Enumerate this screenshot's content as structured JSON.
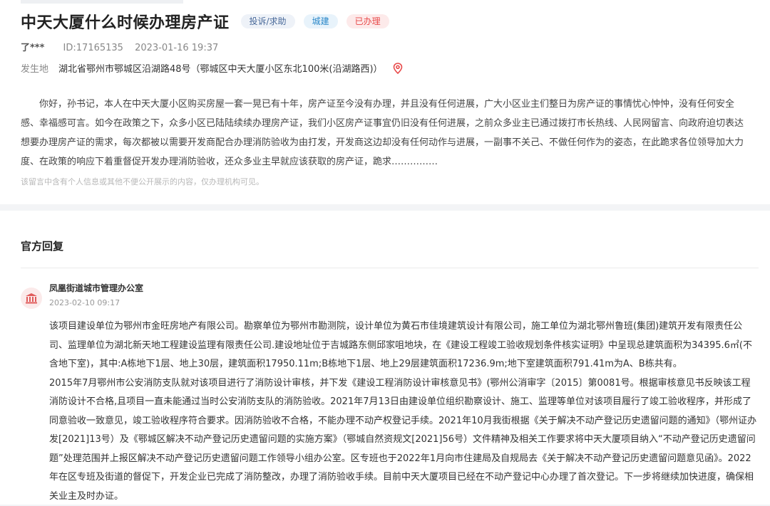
{
  "petition": {
    "title": "中天大厦什么时候办理房产证",
    "tags": {
      "type": "投诉/求助",
      "category": "城建",
      "status": "已办理"
    },
    "author": "了***",
    "id_text": "ID:17165135",
    "datetime": "2023-01-16 19:37",
    "place_label": "发生地",
    "place_value": "湖北省鄂州市鄂城区沿湖路48号（鄂城区中天大厦小区东北100米(沿湖路西)）",
    "place_icon": "location-pin-icon",
    "body": "你好，孙书记，本人在中天大厦小区购买房屋一套一晃已有十年，房产证至今没有办理，并且没有任何进展，广大小区业主们整日为房产证的事情忧心忡忡，没有任何安全感、幸福感可言。如今在政策之下，众多小区已陆陆续续办理房产证，我们小区房产证事宜仍旧没有任何进展，之前众多业主已通过拨打市长热线、人民网留言、向政府迫切表达想要办理房产证的需求，每次都被以需要开发商配合办理消防验收为由打发，开发商这边却没有任何动作与进展，一副事不关己、不做任何作为的姿态，在此跪求各位领导加大力度、在政策的响应下着重督促开发办理消防验收，还众多业主早就应该获取的房产证，跪求……………",
    "privacy_note": "该留言中含有个人信息或其他不便公开展示的内容，仅办理机构可见。"
  },
  "reply": {
    "section_title": "官方回复",
    "org_icon": "government-building-icon",
    "org_name": "凤凰街道城市管理办公室",
    "date": "2023-02-10 09:17",
    "paragraphs": [
      "该项目建设单位为鄂州市金旺房地产有限公司。勘察单位为鄂州市勘测院，设计单位为黄石市佳境建筑设计有限公司，施工单位为湖北鄂州鲁班(集团)建筑开发有限责任公司、监理单位为湖北新天地工程建设监理有限责任公司.建设地址位于吉城路东侧邱家咀地块，在《建设工程竣工验收规划条件核实证明》中呈现总建筑面积为34395.6㎡(不含地下室)，其中:A栋地下1层、地上30层，建筑面积17950.11m;B栋地下1层、地上29层建筑面积17236.9m;地下室建筑面积791.41m为A、B栋共有。",
      "2015年7月鄂州市公安消防支队就对该项目进行了消防设计审核，并下发《建设工程消防设计审核意见书》(鄂州公消审字〔2015〕第0081号。根据审核意见书反映该工程消防设计不合格,且项目一直未能通过当时公安消防支队的消防验收。2021年7月13日由建设单位组织勘察设计、施工、监理等单位对该项目履行了竣工验收程序，并形成了同意验收一致意见，竣工验收程序符合要求。因消防验收不合格，不能办理不动产权登记手续。2021年10月我街根据《关于解决不动产登记历史遗留问题的通知》（鄂州证办发[2021]13号）及《鄂城区解决不动产登记历史遗留问题的实施方案》（鄂城自然资规文[2021]56号）文件精神及相关工作要求将中天大厦项目纳入“不动产登记历史遗留问题”处理范围并上报区解决不动产登记历史遗留问题工作领导小组办公室。区专班也于2022年1月向市住建局及自规局去《关于解决不动产登记历史遗留问题意见函》。2022年在区专班及街道的督促下，开发企业已完成了消防整改，办理了消防验收手续。目前中天大厦项目已经在不动产登记中心办理了首次登记。下一步将继续加快进度，确保相关业主及时办证。"
    ]
  },
  "colors": {
    "status_red": "#e84a4a",
    "category_blue": "#2a87c8",
    "page_bg": "#f3f4f6"
  }
}
